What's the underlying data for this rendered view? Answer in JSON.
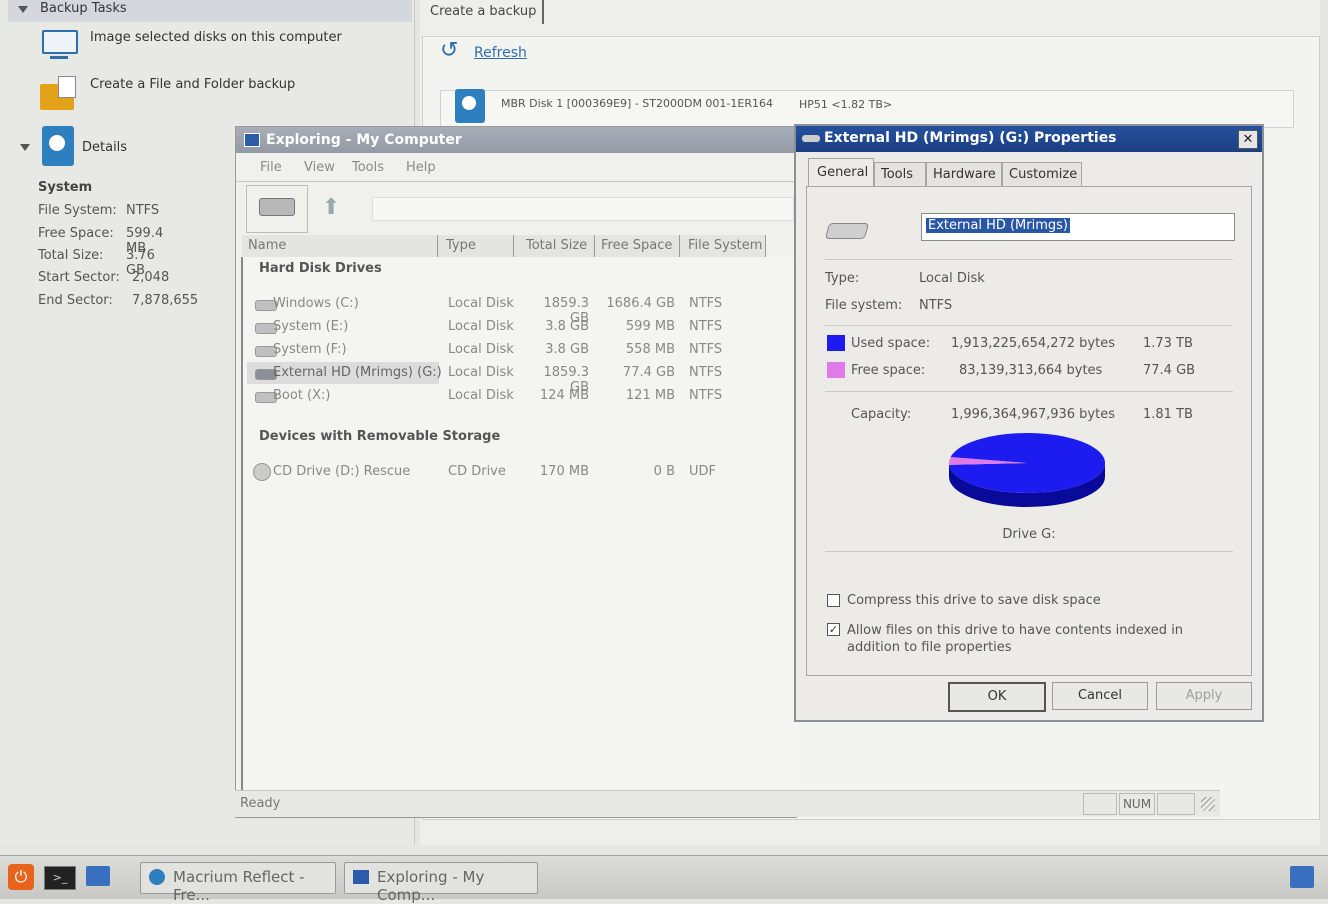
{
  "left_panel": {
    "header": "Backup Tasks",
    "tasks": [
      "Image selected disks on this computer",
      "Create a File and Folder backup"
    ],
    "details_label": "Details",
    "system_title": "System",
    "details": [
      {
        "label": "File System:",
        "value": "NTFS"
      },
      {
        "label": "Free Space:",
        "value": "599.4 MB"
      },
      {
        "label": "Total Size:",
        "value": "3.76 GB"
      },
      {
        "label": "Start Sector:",
        "value": "2,048"
      },
      {
        "label": "End Sector:",
        "value": "7,878,655"
      }
    ]
  },
  "right_panel": {
    "tab": "Create a backup",
    "refresh": "Refresh",
    "disk_line": "MBR Disk 1 [000369E9] - ST2000DM 001-1ER164",
    "disk_extra": "HP51  <1.82 TB>"
  },
  "explorer": {
    "title": "Exploring - My Computer",
    "menu": [
      "File",
      "View",
      "Tools",
      "Help"
    ],
    "columns": [
      "Name",
      "Type",
      "Total Size",
      "Free Space",
      "File System"
    ],
    "group_hdd": "Hard Disk Drives",
    "drives": [
      {
        "name": "Windows (C:)",
        "type": "Local Disk",
        "total": "1859.3 GB",
        "free": "1686.4 GB",
        "fs": "NTFS"
      },
      {
        "name": "System (E:)",
        "type": "Local Disk",
        "total": "3.8 GB",
        "free": "599 MB",
        "fs": "NTFS"
      },
      {
        "name": "System (F:)",
        "type": "Local Disk",
        "total": "3.8 GB",
        "free": "558 MB",
        "fs": "NTFS"
      },
      {
        "name": "External HD (Mrimgs)  (G:)",
        "type": "Local Disk",
        "total": "1859.3 GB",
        "free": "77.4 GB",
        "fs": "NTFS"
      },
      {
        "name": "Boot (X:)",
        "type": "Local Disk",
        "total": "124 MB",
        "free": "121 MB",
        "fs": "NTFS"
      }
    ],
    "group_removable": "Devices with Removable Storage",
    "removable": [
      {
        "name": "CD Drive (D:) Rescue",
        "type": "CD Drive",
        "total": "170 MB",
        "free": "0 B",
        "fs": "UDF"
      }
    ],
    "status": "Ready",
    "status_num": "NUM"
  },
  "properties": {
    "title": "External HD (Mrimgs)  (G:) Properties",
    "tabs": [
      "General",
      "Tools",
      "Hardware",
      "Customize"
    ],
    "name_value": "External HD (Mrimgs)",
    "type_label": "Type:",
    "type_value": "Local Disk",
    "fs_label": "File system:",
    "fs_value": "NTFS",
    "used_label": "Used space:",
    "used_bytes": "1,913,225,654,272 bytes",
    "used_size": "1.73 TB",
    "free_label": "Free space:",
    "free_bytes": "83,139,313,664 bytes",
    "free_size": "77.4 GB",
    "capacity_label": "Capacity:",
    "capacity_bytes": "1,996,364,967,936 bytes",
    "capacity_size": "1.81 TB",
    "drive_label": "Drive G:",
    "used_fraction": 0.9584,
    "used_color": "#1c1cf0",
    "free_color": "#e07ae8",
    "compress_label": "Compress this drive to save disk space",
    "compress_checked": false,
    "index_label": "Allow files on this drive to have contents indexed in addition to file properties",
    "index_checked": true,
    "ok": "OK",
    "cancel": "Cancel",
    "apply": "Apply"
  },
  "taskbar": {
    "items": [
      "Macrium Reflect - Fre...",
      "Exploring - My Comp..."
    ]
  }
}
